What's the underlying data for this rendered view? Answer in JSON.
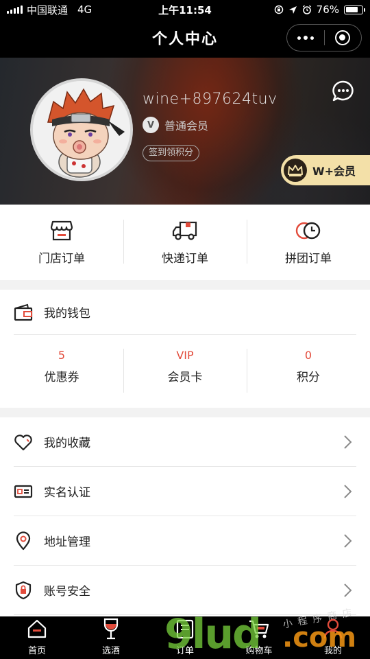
{
  "status_bar": {
    "carrier": "中国联通",
    "network": "4G",
    "time": "上午11:54",
    "battery_percent": "76%",
    "battery_level": 0.76
  },
  "nav": {
    "title": "个人中心"
  },
  "profile": {
    "username": "wine+897624tuv",
    "member_badge": "V",
    "member_level": "普通会员",
    "signin_label": "签到领积分",
    "wplus_label": "W+会员"
  },
  "orders": [
    {
      "label": "门店订单",
      "icon": "store-icon"
    },
    {
      "label": "快递订单",
      "icon": "truck-icon"
    },
    {
      "label": "拼团订单",
      "icon": "group-clock-icon"
    }
  ],
  "wallet": {
    "title": "我的钱包",
    "stats": [
      {
        "value": "5",
        "label": "优惠券"
      },
      {
        "value": "VIP",
        "label": "会员卡"
      },
      {
        "value": "0",
        "label": "积分"
      }
    ]
  },
  "menu": [
    {
      "label": "我的收藏",
      "icon": "heart-icon"
    },
    {
      "label": "实名认证",
      "icon": "id-card-icon"
    },
    {
      "label": "地址管理",
      "icon": "location-pin-icon"
    },
    {
      "label": "账号安全",
      "icon": "shield-lock-icon"
    }
  ],
  "tabbar": [
    {
      "label": "首页",
      "icon": "home-icon"
    },
    {
      "label": "选酒",
      "icon": "wine-glass-icon"
    },
    {
      "label": "订单",
      "icon": "order-icon"
    },
    {
      "label": "购物车",
      "icon": "cart-icon"
    },
    {
      "label": "我的",
      "icon": "user-icon"
    }
  ],
  "watermark": {
    "big": "9lud",
    "com": ".com",
    "small": "小程序商店"
  },
  "colors": {
    "accent_red": "#e24b3b",
    "gold": "#f3e0a8",
    "bar_black": "#000000"
  }
}
